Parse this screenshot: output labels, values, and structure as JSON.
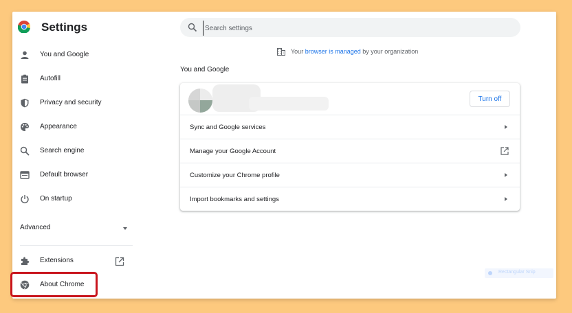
{
  "header": {
    "title": "Settings",
    "search_placeholder": "Search settings"
  },
  "sidebar": {
    "items": [
      {
        "label": "You and Google",
        "icon": "person-icon"
      },
      {
        "label": "Autofill",
        "icon": "clipboard-icon"
      },
      {
        "label": "Privacy and security",
        "icon": "shield-icon"
      },
      {
        "label": "Appearance",
        "icon": "palette-icon"
      },
      {
        "label": "Search engine",
        "icon": "search-icon"
      },
      {
        "label": "Default browser",
        "icon": "browser-icon"
      },
      {
        "label": "On startup",
        "icon": "power-icon"
      }
    ],
    "advanced_label": "Advanced",
    "extensions_label": "Extensions",
    "about_label": "About Chrome"
  },
  "main": {
    "managed_prefix": "Your ",
    "managed_link": "browser is managed",
    "managed_suffix": " by your organization",
    "section_title": "You and Google",
    "turn_off_label": "Turn off",
    "rows": [
      {
        "label": "Sync and Google services",
        "action": "arrow"
      },
      {
        "label": "Manage your Google Account",
        "action": "external"
      },
      {
        "label": "Customize your Chrome profile",
        "action": "arrow"
      },
      {
        "label": "Import bookmarks and settings",
        "action": "arrow"
      }
    ]
  },
  "overlay": {
    "faded_text": "Rectangular Snip"
  },
  "colors": {
    "accent": "#1a73e8",
    "highlight": "#c8151d",
    "background": "#fdc97e"
  }
}
